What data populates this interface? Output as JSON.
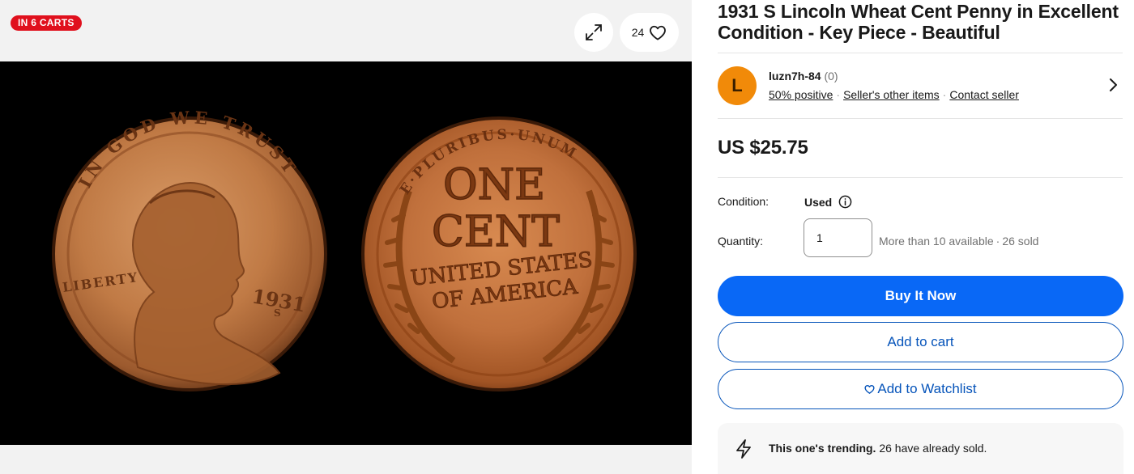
{
  "gallery": {
    "cart_badge": "IN 6 CARTS",
    "watch_count": "24",
    "image_alt": "1931 S Lincoln Wheat Cent obverse and reverse",
    "coin_text": {
      "obverse_motto": "IN GOD WE TRUST",
      "obverse_liberty": "LIBERTY",
      "obverse_year": "1931",
      "obverse_mint": "S",
      "reverse_top": "E·PLURIBUS·UNUM",
      "reverse_line1": "ONE",
      "reverse_line2": "CENT",
      "reverse_line3": "UNITED STATES",
      "reverse_line4": "OF AMERICA"
    },
    "icons": [
      "expand-icon",
      "heart-icon"
    ]
  },
  "listing": {
    "title": "1931 S Lincoln Wheat Cent Penny in Excellent Condition - Key Piece - Beautiful",
    "seller": {
      "avatar_letter": "L",
      "name": "luzn7h-84",
      "feedback_count": "(0)",
      "positive": "50% positive",
      "other_items": "Seller's other items",
      "contact": "Contact seller"
    },
    "price": "US $25.75",
    "condition_label": "Condition:",
    "condition_value": "Used",
    "quantity_label": "Quantity:",
    "quantity_value": "1",
    "availability": "More than 10 available",
    "sold": "26 sold",
    "buttons": {
      "buy_now": "Buy It Now",
      "add_to_cart": "Add to cart",
      "add_to_watchlist": "Add to Watchlist"
    },
    "trending_bold": "This one's trending.",
    "trending_rest": "26 have already sold."
  },
  "colors": {
    "accent_blue": "#0968f6",
    "link_blue": "#0654ba",
    "badge_red": "#e0101d",
    "avatar_orange": "#f18a09"
  }
}
